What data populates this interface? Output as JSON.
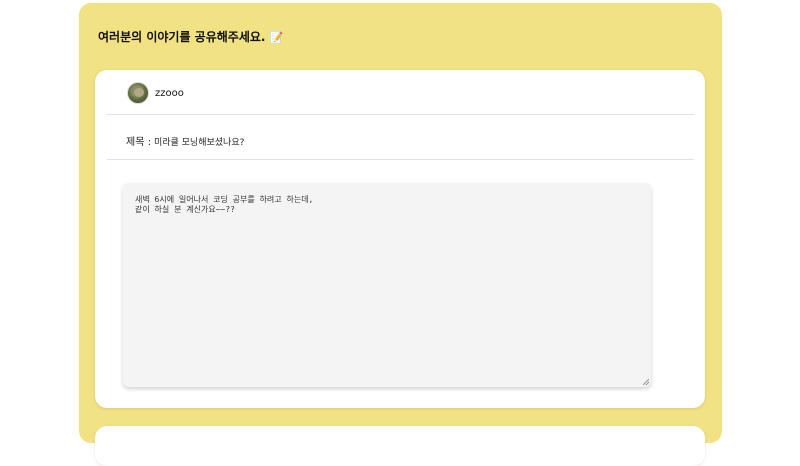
{
  "board": {
    "heading": "여러분의 이야기를 공유해주세요.",
    "heading_emoji": "📝"
  },
  "post": {
    "author": "zzooo",
    "title_label": "제목 :",
    "title": "미라클 모닝해보셨나요?",
    "body_lines": [
      "새벽 6시에 일어나서 코딩 공부를 하려고 하는데,",
      "같이 하실 분 계신가요~~??"
    ]
  }
}
